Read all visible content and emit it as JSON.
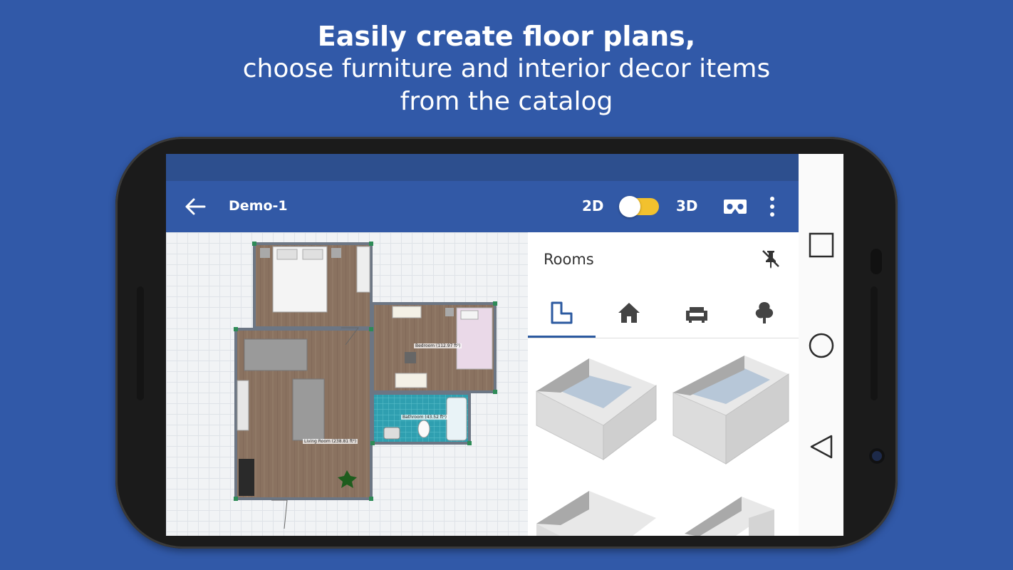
{
  "headline": {
    "line1": "Easily create floor plans,",
    "line2": "choose furniture and interior decor items",
    "line3": "from the catalog"
  },
  "appbar": {
    "title": "Demo-1",
    "mode_2d": "2D",
    "mode_3d": "3D",
    "toggle_state": "3D",
    "icons": [
      "back-arrow-icon",
      "vr-headset-icon",
      "more-vert-icon"
    ]
  },
  "floorplan": {
    "rooms": [
      {
        "label": "Bedroom (112.97 ft²)"
      },
      {
        "label": "Bathroom (43.52 ft²)"
      },
      {
        "label": "Living Room (238.81 ft²)"
      }
    ]
  },
  "panel": {
    "title": "Rooms",
    "pin_icon": "unpin-icon",
    "tabs": [
      {
        "icon": "room-shape-icon",
        "active": true
      },
      {
        "icon": "home-icon",
        "active": false
      },
      {
        "icon": "sofa-icon",
        "active": false
      },
      {
        "icon": "tree-icon",
        "active": false
      }
    ]
  },
  "navbar": {
    "icons": [
      "recents-square-icon",
      "home-circle-icon",
      "back-triangle-icon"
    ]
  },
  "colors": {
    "background": "#3159a8",
    "appbar": "#3259a6",
    "statusbar": "#2d4f8e",
    "toggle": "#f2c12e",
    "tab_indicator": "#2c5aa0"
  }
}
